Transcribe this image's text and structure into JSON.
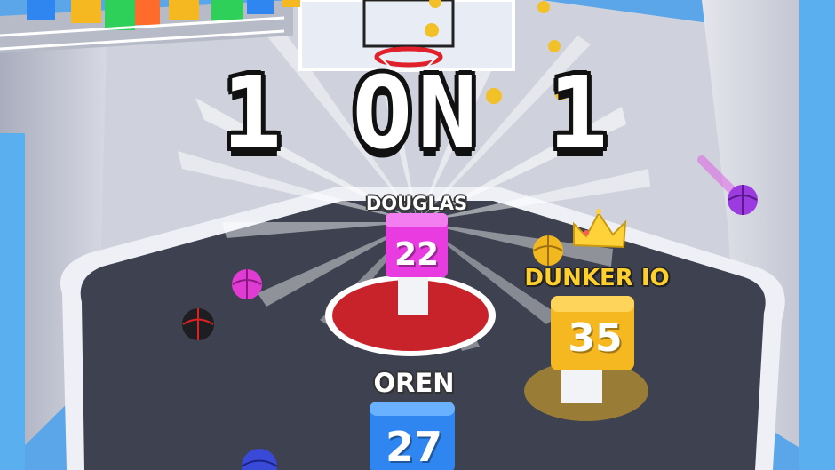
{
  "game": {
    "title": "1 ON 1"
  },
  "players": [
    {
      "name": "DOUGLAS",
      "score": "22",
      "color": "#e83be0",
      "leader": false
    },
    {
      "name": "DUNKER IO",
      "score": "35",
      "color": "#f5b820",
      "leader": true
    },
    {
      "name": "OREN",
      "score": "27",
      "color": "#2f86f0",
      "leader": false
    }
  ],
  "colors": {
    "sky": "#5aa6e8",
    "floor": "#3d4150",
    "wall": "#c9ccd8",
    "center_circle": "#c8232b",
    "coin": "#f2c027"
  }
}
